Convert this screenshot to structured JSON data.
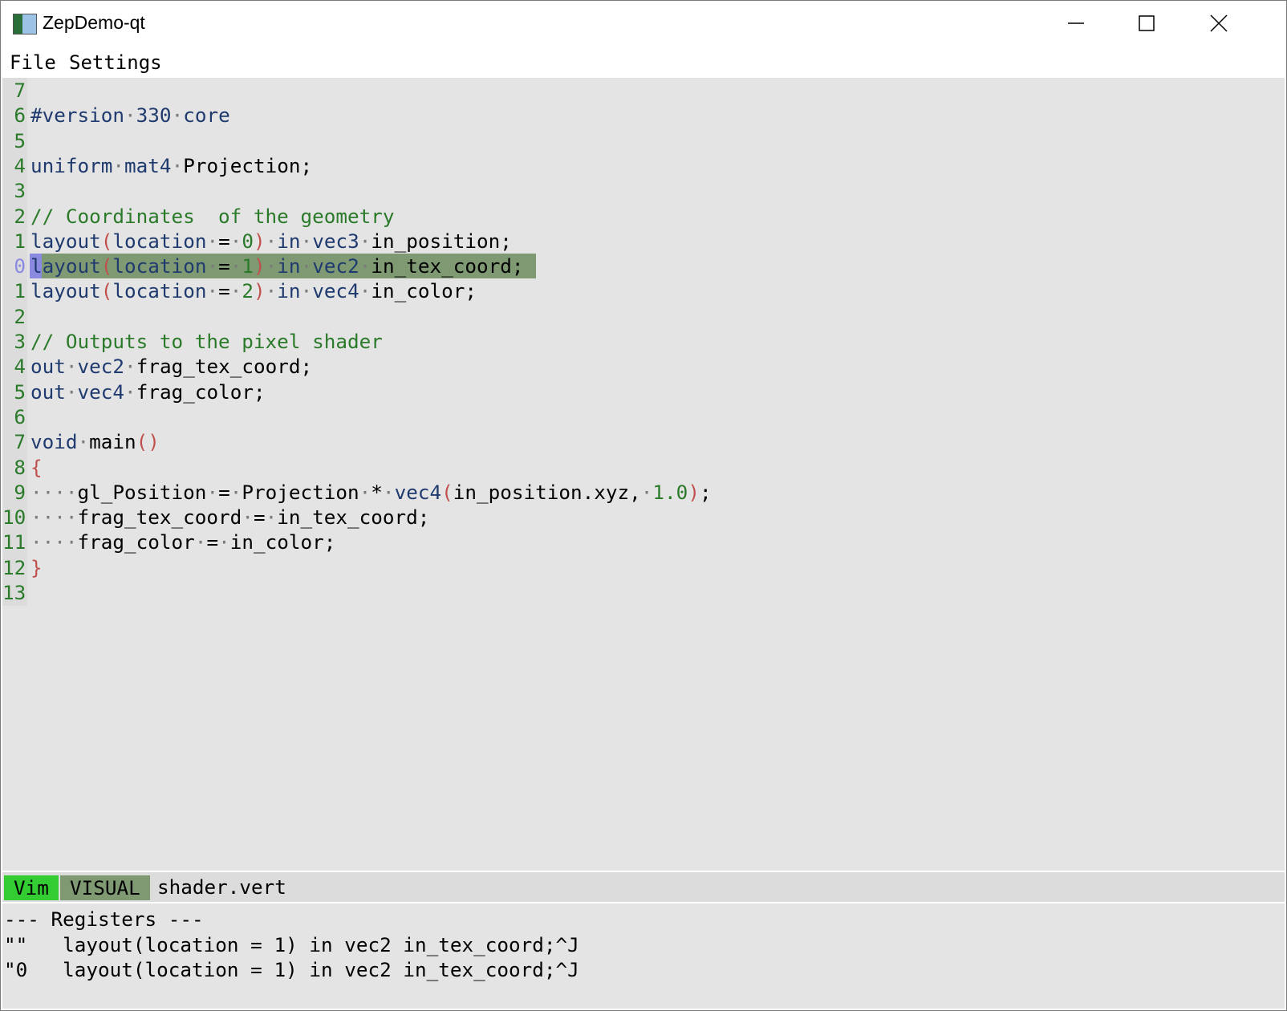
{
  "window": {
    "title": "ZepDemo-qt"
  },
  "menu": [
    "File",
    "Settings"
  ],
  "editor": {
    "cursor_line_index": 7,
    "selection_color": "#7f9a73",
    "cursor_color": "#8a8ae0",
    "lines": [
      {
        "num": "7",
        "tokens": []
      },
      {
        "num": "6",
        "tokens": [
          [
            "#version",
            "k"
          ],
          [
            "·",
            "w"
          ],
          [
            "330",
            "k"
          ],
          [
            "·",
            "w"
          ],
          [
            "core",
            "k"
          ]
        ]
      },
      {
        "num": "5",
        "tokens": []
      },
      {
        "num": "4",
        "tokens": [
          [
            "uniform",
            "k"
          ],
          [
            "·",
            "w"
          ],
          [
            "mat4",
            "k"
          ],
          [
            "·",
            "w"
          ],
          [
            "Projection;",
            "p"
          ]
        ]
      },
      {
        "num": "3",
        "tokens": []
      },
      {
        "num": "2",
        "tokens": [
          [
            "// Coordinates  of the geometry",
            "c"
          ]
        ]
      },
      {
        "num": "1",
        "tokens": [
          [
            "layout",
            "k"
          ],
          [
            "(",
            "b"
          ],
          [
            "location",
            "k"
          ],
          [
            "·",
            "w"
          ],
          [
            "=",
            "p"
          ],
          [
            "·",
            "w"
          ],
          [
            "0",
            "n"
          ],
          [
            ")",
            "b"
          ],
          [
            "·",
            "w"
          ],
          [
            "in",
            "k"
          ],
          [
            "·",
            "w"
          ],
          [
            "vec3",
            "k"
          ],
          [
            "·",
            "w"
          ],
          [
            "in_position;",
            "p"
          ]
        ]
      },
      {
        "num": "0",
        "tokens": [
          [
            "layout",
            "k"
          ],
          [
            "(",
            "b"
          ],
          [
            "location",
            "k"
          ],
          [
            "·",
            "w"
          ],
          [
            "=",
            "p"
          ],
          [
            "·",
            "w"
          ],
          [
            "1",
            "n"
          ],
          [
            ")",
            "b"
          ],
          [
            "·",
            "w"
          ],
          [
            "in",
            "k"
          ],
          [
            "·",
            "w"
          ],
          [
            "vec2",
            "k"
          ],
          [
            "·",
            "w"
          ],
          [
            "in_tex_coord;",
            "p"
          ]
        ]
      },
      {
        "num": "1",
        "tokens": [
          [
            "layout",
            "k"
          ],
          [
            "(",
            "b"
          ],
          [
            "location",
            "k"
          ],
          [
            "·",
            "w"
          ],
          [
            "=",
            "p"
          ],
          [
            "·",
            "w"
          ],
          [
            "2",
            "n"
          ],
          [
            ")",
            "b"
          ],
          [
            "·",
            "w"
          ],
          [
            "in",
            "k"
          ],
          [
            "·",
            "w"
          ],
          [
            "vec4",
            "k"
          ],
          [
            "·",
            "w"
          ],
          [
            "in_color;",
            "p"
          ]
        ]
      },
      {
        "num": "2",
        "tokens": []
      },
      {
        "num": "3",
        "tokens": [
          [
            "// Outputs to the pixel shader",
            "c"
          ]
        ]
      },
      {
        "num": "4",
        "tokens": [
          [
            "out",
            "k"
          ],
          [
            "·",
            "w"
          ],
          [
            "vec2",
            "k"
          ],
          [
            "·",
            "w"
          ],
          [
            "frag_tex_coord;",
            "p"
          ]
        ]
      },
      {
        "num": "5",
        "tokens": [
          [
            "out",
            "k"
          ],
          [
            "·",
            "w"
          ],
          [
            "vec4",
            "k"
          ],
          [
            "·",
            "w"
          ],
          [
            "frag_color;",
            "p"
          ]
        ]
      },
      {
        "num": "6",
        "tokens": []
      },
      {
        "num": "7",
        "tokens": [
          [
            "void",
            "k"
          ],
          [
            "·",
            "w"
          ],
          [
            "main",
            "p"
          ],
          [
            "()",
            "b"
          ]
        ]
      },
      {
        "num": "8",
        "tokens": [
          [
            "{",
            "b"
          ]
        ]
      },
      {
        "num": "9",
        "tokens": [
          [
            "····",
            "w"
          ],
          [
            "gl_Position",
            "p"
          ],
          [
            "·",
            "w"
          ],
          [
            "=",
            "p"
          ],
          [
            "·",
            "w"
          ],
          [
            "Projection",
            "p"
          ],
          [
            "·",
            "w"
          ],
          [
            "*",
            "p"
          ],
          [
            "·",
            "w"
          ],
          [
            "vec4",
            "k"
          ],
          [
            "(",
            "b"
          ],
          [
            "in_position.xyz,",
            "p"
          ],
          [
            "·",
            "w"
          ],
          [
            "1.0",
            "n"
          ],
          [
            ")",
            "b"
          ],
          [
            ";",
            "p"
          ]
        ]
      },
      {
        "num": "10",
        "tokens": [
          [
            "····",
            "w"
          ],
          [
            "frag_tex_coord",
            "p"
          ],
          [
            "·",
            "w"
          ],
          [
            "=",
            "p"
          ],
          [
            "·",
            "w"
          ],
          [
            "in_tex_coord;",
            "p"
          ]
        ]
      },
      {
        "num": "11",
        "tokens": [
          [
            "····",
            "w"
          ],
          [
            "frag_color",
            "p"
          ],
          [
            "·",
            "w"
          ],
          [
            "=",
            "p"
          ],
          [
            "·",
            "w"
          ],
          [
            "in_color;",
            "p"
          ]
        ]
      },
      {
        "num": "12",
        "tokens": [
          [
            "}",
            "b"
          ]
        ]
      },
      {
        "num": "13",
        "tokens": []
      }
    ]
  },
  "status": {
    "mode_editor": "Vim",
    "mode": "VISUAL",
    "filename": "shader.vert",
    "vim_color": "#33cc33"
  },
  "registers": {
    "header": "--- Registers ---",
    "entries": [
      "\"\"   layout(location = 1) in vec2 in_tex_coord;^J",
      "\"0   layout(location = 1) in vec2 in_tex_coord;^J"
    ]
  }
}
